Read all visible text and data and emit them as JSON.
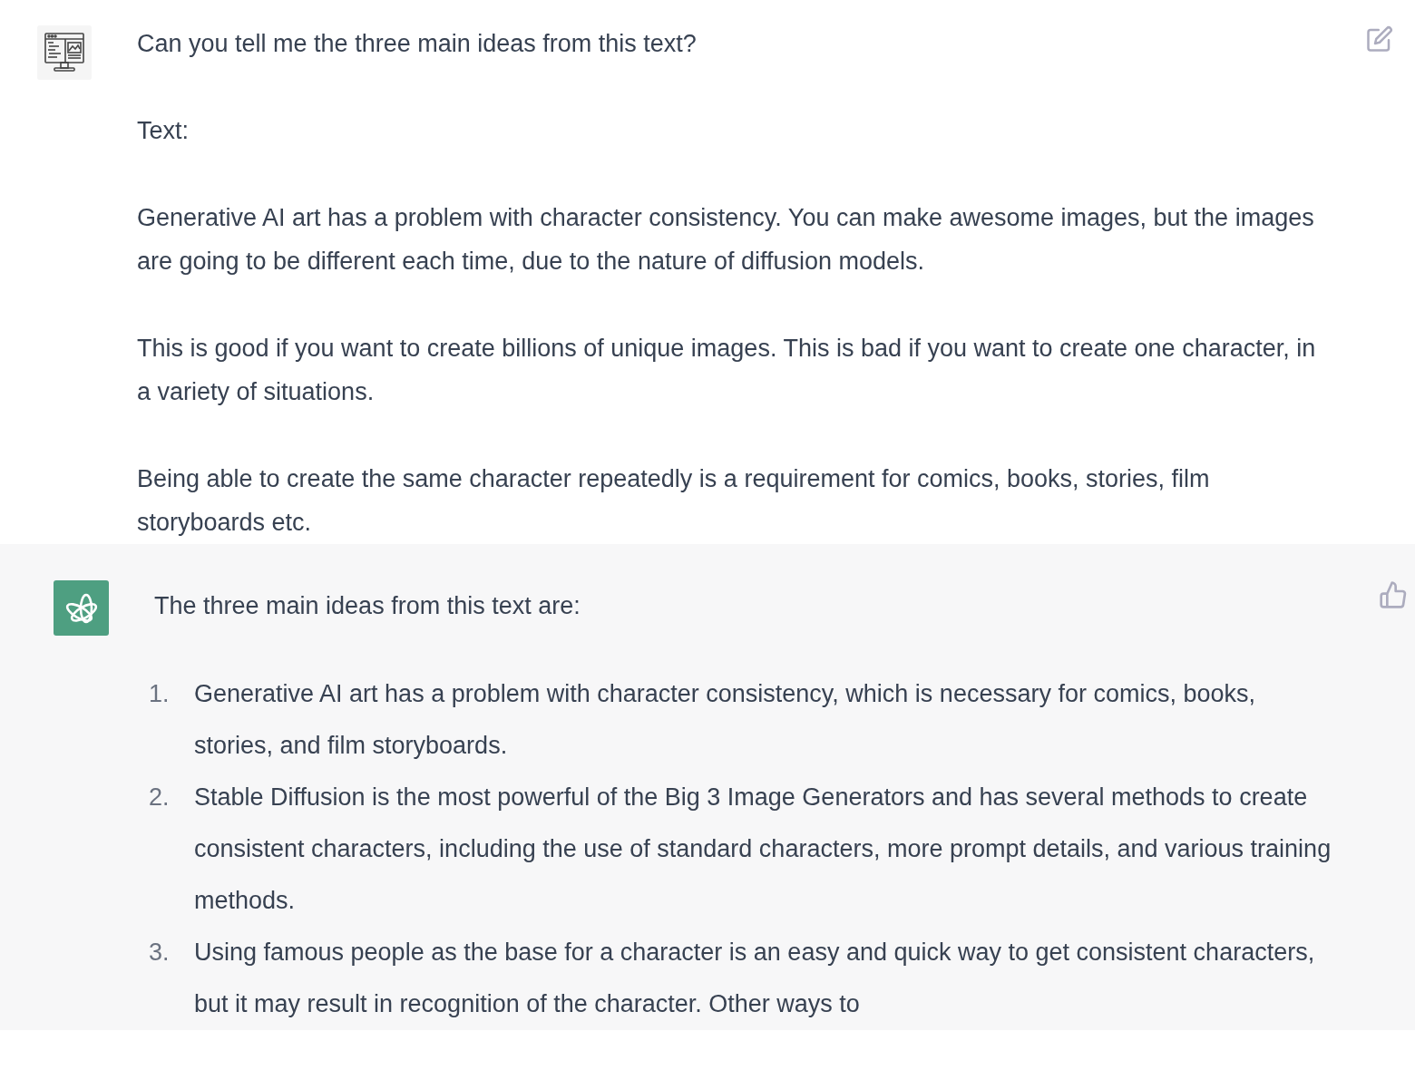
{
  "user_message": {
    "paragraphs": [
      "Can you tell me the three main ideas from this text?",
      "Text:",
      "Generative AI art has a problem with character consistency. You can make awesome images, but the images are going to be different each time, due to the nature of diffusion models.",
      "This is good if you want to create billions of unique images. This is bad if you want to create one character, in a variety of situations.",
      "Being able to create the same character repeatedly is a requirement for comics, books, stories, film storyboards etc."
    ]
  },
  "assistant_message": {
    "intro": "The three main ideas from this text are:",
    "items": [
      {
        "number": "1.",
        "text": "Generative AI art has a problem with character consistency, which is necessary for comics, books, stories, and film storyboards."
      },
      {
        "number": "2.",
        "text": "Stable Diffusion is the most powerful of the Big 3 Image Generators and has several methods to create consistent characters, including the use of standard characters, more prompt details, and various training methods."
      },
      {
        "number": "3.",
        "text": "Using famous people as the base for a character is an easy and quick way to get consistent characters, but it may result in recognition of the character. Other ways to"
      }
    ]
  }
}
